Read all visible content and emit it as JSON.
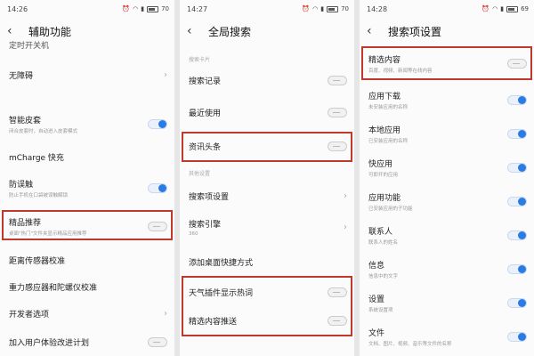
{
  "screens": [
    {
      "time": "14:26",
      "battery": "70",
      "title": "辅助功能",
      "partial_top_text": "定时开关机",
      "rows": [
        {
          "title": "无障碍",
          "sub": "",
          "control": "chevron"
        },
        {
          "title": "智能皮套",
          "sub": "闭合皮套时，自动进入皮套模式",
          "control": "on"
        },
        {
          "title": "mCharge 快充",
          "sub": "",
          "control": "none"
        },
        {
          "title": "防误触",
          "sub": "防止手机在口袋被误触解锁",
          "control": "on"
        },
        {
          "title": "精品推荐",
          "sub": "桌面\"热门\"文件夹显示精品应用推荐",
          "control": "off"
        },
        {
          "title": "距离传感器校准",
          "sub": "",
          "control": "none"
        },
        {
          "title": "重力感应器和陀螺仪校准",
          "sub": "",
          "control": "none"
        },
        {
          "title": "开发者选项",
          "sub": "",
          "control": "chevron"
        },
        {
          "title": "加入用户体验改进计划",
          "sub": "",
          "control": "off"
        }
      ]
    },
    {
      "time": "14:27",
      "battery": "70",
      "title": "全局搜索",
      "section1": "搜索卡片",
      "section2": "其他设置",
      "rows": [
        {
          "title": "搜索记录",
          "sub": "",
          "control": "off"
        },
        {
          "title": "最近使用",
          "sub": "",
          "control": "off"
        },
        {
          "title": "资讯头条",
          "sub": "",
          "control": "off"
        },
        {
          "title": "搜索项设置",
          "sub": "",
          "control": "chevron"
        },
        {
          "title": "搜索引擎",
          "sub": "360",
          "control": "chevron"
        },
        {
          "title": "添加桌面快捷方式",
          "sub": "",
          "control": "none"
        },
        {
          "title": "天气插件显示热词",
          "sub": "",
          "control": "off"
        },
        {
          "title": "精选内容推送",
          "sub": "",
          "control": "off"
        }
      ]
    },
    {
      "time": "14:28",
      "battery": "69",
      "title": "搜索项设置",
      "rows": [
        {
          "title": "精选内容",
          "sub": "百度、视频、新闻等在线内容",
          "control": "off"
        },
        {
          "title": "应用下载",
          "sub": "未安装应用的名称",
          "control": "on"
        },
        {
          "title": "本地应用",
          "sub": "已安装应用的名称",
          "control": "on"
        },
        {
          "title": "快应用",
          "sub": "可即开的应用",
          "control": "on"
        },
        {
          "title": "应用功能",
          "sub": "已安装应用的子功能",
          "control": "on"
        },
        {
          "title": "联系人",
          "sub": "联系人的姓名",
          "control": "on"
        },
        {
          "title": "信息",
          "sub": "信息中的文字",
          "control": "on"
        },
        {
          "title": "设置",
          "sub": "系统设置项",
          "control": "on"
        },
        {
          "title": "文件",
          "sub": "文档、图片、视频、音乐等文件的名称",
          "control": "on"
        }
      ]
    }
  ]
}
